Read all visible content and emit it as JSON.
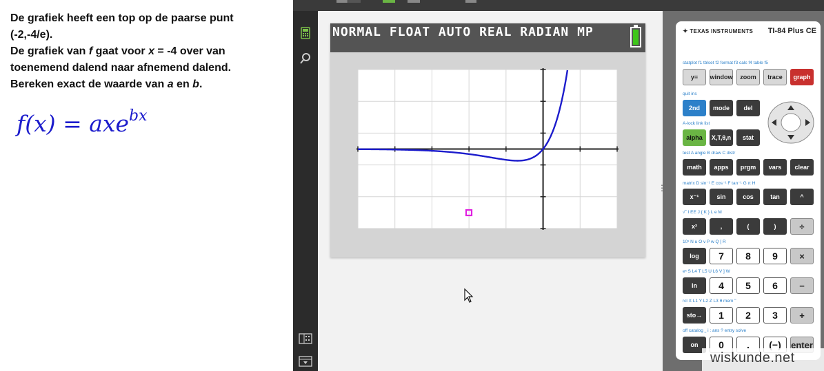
{
  "lesson": {
    "line1": "De grafiek heeft een top op de paarse punt",
    "line2": "(-2,-4/e).",
    "line3_pre": "De grafiek van ",
    "line3_f": "f",
    "line3_mid": " gaat voor ",
    "line3_x": "x",
    "line3_post": " = -4 over van",
    "line4": "toenemend dalend naar afnemend dalend.",
    "line5_pre": "Bereken exact de waarde van ",
    "line5_a": "a",
    "line5_mid": " en ",
    "line5_b": "b",
    "line5_post": ".",
    "formula_lhs": "f(x) = axe",
    "formula_exp": "bx"
  },
  "calculator": {
    "status": "NORMAL FLOAT AUTO REAL RADIAN MP",
    "battery_level": 1.0,
    "brand": "Texas Instruments",
    "model": "TI-84 Plus CE"
  },
  "graph": {
    "xlim": [
      -10,
      10
    ],
    "ylim": [
      -10,
      10
    ],
    "xscl": 1,
    "yscl": 1,
    "curve_color": "#1c1ccc",
    "point": {
      "x": -2,
      "y": -1.4715,
      "color": "#e020e0"
    }
  },
  "colors": {
    "accent_blue": "#2c80c9",
    "accent_green": "#6ab544",
    "accent_red": "#c8302e"
  },
  "keypad": {
    "rows": [
      {
        "sec": "statplot f1   tblset f2  format f3  calc  f4  table  f5",
        "keys": [
          [
            "y=",
            "grey"
          ],
          [
            "window",
            "grey"
          ],
          [
            "zoom",
            "grey"
          ],
          [
            "trace",
            "grey"
          ],
          [
            "graph",
            "red"
          ]
        ]
      },
      {
        "sec": "               quit         ins",
        "keys": [
          [
            "2nd",
            "blue"
          ],
          [
            "mode",
            "dark"
          ],
          [
            "del",
            "dark"
          ]
        ]
      },
      {
        "sec": "A-lock         link         list",
        "keys": [
          [
            "alpha",
            "green"
          ],
          [
            "X,T,θ,n",
            "dark"
          ],
          [
            "stat",
            "dark"
          ]
        ]
      },
      {
        "sec": "test   A   angle  B   draw  C   distr",
        "keys": [
          [
            "math",
            "dark"
          ],
          [
            "apps",
            "dark"
          ],
          [
            "prgm",
            "dark"
          ],
          [
            "vars",
            "dark"
          ],
          [
            "clear",
            "dark"
          ]
        ]
      },
      {
        "sec": "matrix D  sin⁻¹  E  cos⁻¹  F  tan⁻¹ G  π    H",
        "keys": [
          [
            "x⁻¹",
            "dark"
          ],
          [
            "sin",
            "dark"
          ],
          [
            "cos",
            "dark"
          ],
          [
            "tan",
            "dark"
          ],
          [
            "^",
            "dark"
          ]
        ]
      },
      {
        "sec": "√‾      I  EE     J   {     K   }      L   e     M",
        "keys": [
          [
            "x²",
            "dark"
          ],
          [
            ",",
            "dark"
          ],
          [
            "(",
            "dark"
          ],
          [
            ")",
            "dark"
          ],
          [
            "÷",
            "op"
          ]
        ]
      },
      {
        "sec": "10ˣ    N  u      O  v      P  w      Q  [      R",
        "keys": [
          [
            "log",
            "dark"
          ],
          [
            "7",
            "white"
          ],
          [
            "8",
            "white"
          ],
          [
            "9",
            "white"
          ],
          [
            "×",
            "op"
          ]
        ]
      },
      {
        "sec": "eˣ      S  L4     T  L5     U  L6     V  ]      W",
        "keys": [
          [
            "ln",
            "dark"
          ],
          [
            "4",
            "white"
          ],
          [
            "5",
            "white"
          ],
          [
            "6",
            "white"
          ],
          [
            "−",
            "op"
          ]
        ]
      },
      {
        "sec": "rcl     X  L1     Y  L2     Z  L3     θ  mem  \"",
        "keys": [
          [
            "sto→",
            "dark"
          ],
          [
            "1",
            "white"
          ],
          [
            "2",
            "white"
          ],
          [
            "3",
            "white"
          ],
          [
            "+",
            "op"
          ]
        ]
      },
      {
        "sec": "off           catalog ⎵  i      :   ans    ?  entry solve",
        "keys": [
          [
            "on",
            "dark"
          ],
          [
            "0",
            "white"
          ],
          [
            ".",
            "white"
          ],
          [
            "(−)",
            "white"
          ],
          [
            "enter",
            "op"
          ]
        ]
      }
    ]
  },
  "watermark": "wiskunde.net"
}
